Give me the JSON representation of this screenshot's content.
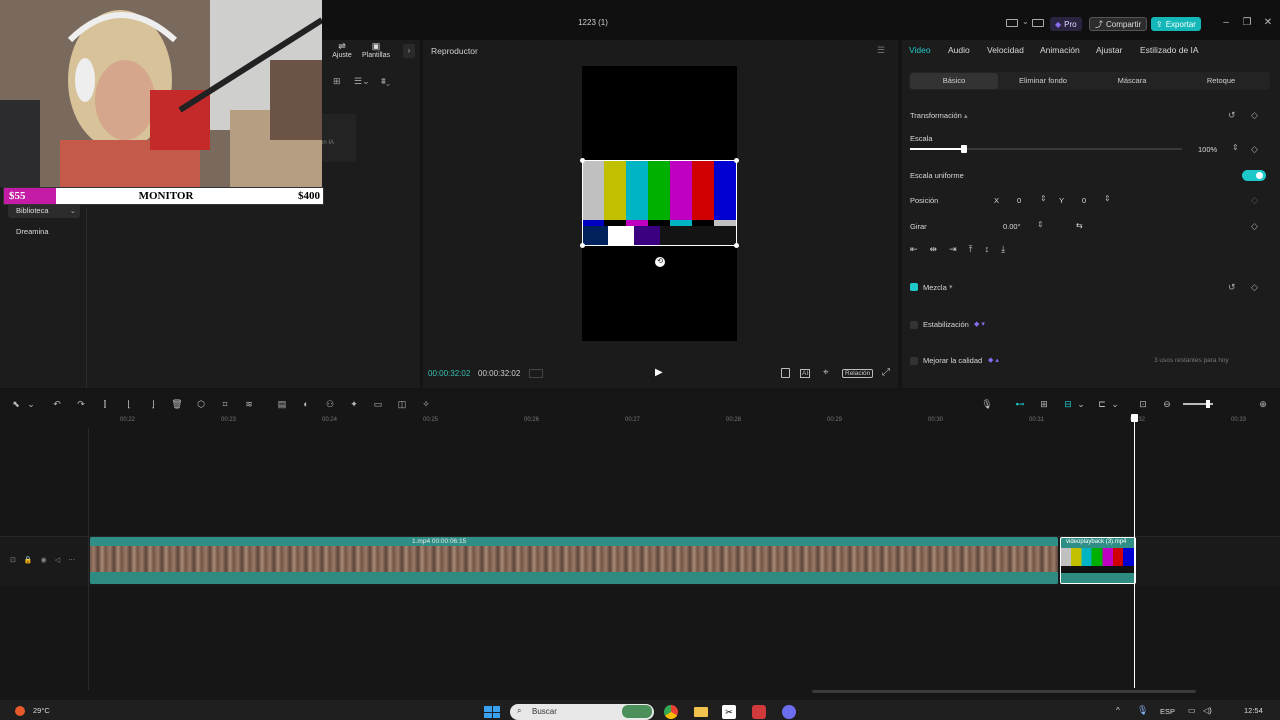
{
  "window": {
    "title": "1223 (1)"
  },
  "header": {
    "pro_label": "Pro",
    "share_label": "Compartir",
    "export_label": "Exportar"
  },
  "stream_overlay": {
    "left_price": "$55",
    "center_label": "MONITOR",
    "right_price": "$400"
  },
  "left_panel": {
    "tabs": [
      {
        "label": "Ajuste"
      },
      {
        "label": "Plantillas"
      }
    ],
    "items": [
      {
        "label": "Biblioteca"
      },
      {
        "label": "Dreamina"
      }
    ],
    "hint": "on IA"
  },
  "player": {
    "title": "Reproductor",
    "current_time": "00:00:32:02",
    "total_time": "00:00:32:02",
    "ratio_label": "Relación"
  },
  "right_panel": {
    "tabs": [
      "Video",
      "Audio",
      "Velocidad",
      "Animación",
      "Ajustar",
      "Estilizado de IA"
    ],
    "subtabs": [
      "Básico",
      "Eliminar fondo",
      "Máscara",
      "Retoque"
    ],
    "transform_label": "Transformación",
    "scale_label": "Escala",
    "scale_value": "100%",
    "scale_fraction": 0.2,
    "uniform_scale_label": "Escala uniforme",
    "position_label": "Posición",
    "x_label": "X",
    "x_value": "0",
    "y_label": "Y",
    "y_value": "0",
    "rotate_label": "Girar",
    "rotate_value": "0.00°",
    "blend_label": "Mezcla",
    "stabilize_label": "Estabilización",
    "quality_label": "Mejorar la calidad",
    "quality_note": "3 usos restantes para hoy"
  },
  "timeline": {
    "ticks": [
      "00:22",
      "00:23",
      "00:24",
      "00:25",
      "00:26",
      "00:27",
      "00:28",
      "00:29",
      "00:30",
      "00:31",
      "00:32",
      "00:33"
    ],
    "main_clip_label": "1.mp4   00:00:06:15",
    "video_clip_label": "videoplayback (3).mp4"
  },
  "taskbar": {
    "weather": "29°C",
    "search_placeholder": "Buscar",
    "language": "ESP",
    "time": "12:54"
  },
  "colors": {
    "accent": "#20c5c5",
    "teal_clip": "#2f8f86",
    "pro_purple": "#8a6cf0"
  }
}
